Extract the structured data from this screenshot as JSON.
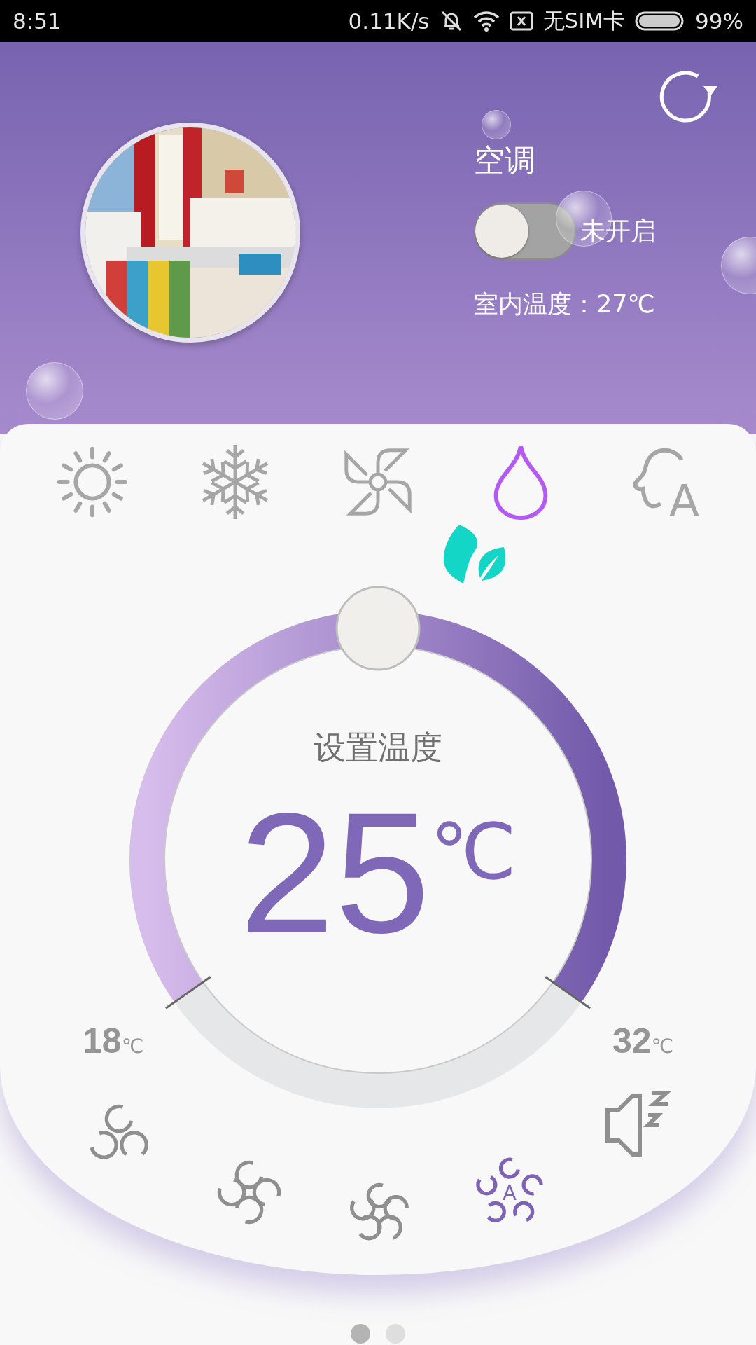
{
  "status_bar": {
    "time": "8:51",
    "net_speed": "0.11K/s",
    "sim": "无SIM卡",
    "battery": "99%"
  },
  "header": {
    "title": "空调",
    "power": {
      "on": false,
      "label": "未开启"
    },
    "indoor": "室内温度：27℃"
  },
  "modes": [
    {
      "kind": "heat",
      "selected": false
    },
    {
      "kind": "cool",
      "selected": false
    },
    {
      "kind": "fan",
      "selected": false
    },
    {
      "kind": "dry",
      "selected": true
    },
    {
      "kind": "auto",
      "selected": false,
      "label": "A"
    }
  ],
  "eco": {
    "on": true
  },
  "dial": {
    "label": "设置温度",
    "value": "25",
    "unit": "℃",
    "level": 0.5,
    "min": "18",
    "min_unit": "℃",
    "max": "32",
    "max_unit": "℃"
  },
  "fan_speeds": [
    {
      "kind": "low",
      "selected": false
    },
    {
      "kind": "medium",
      "selected": false
    },
    {
      "kind": "high",
      "selected": false
    },
    {
      "kind": "auto",
      "selected": true,
      "label": "A"
    }
  ],
  "sleep": {
    "on": false
  },
  "pages": [
    {
      "selected": true
    },
    {
      "selected": false
    }
  ]
}
